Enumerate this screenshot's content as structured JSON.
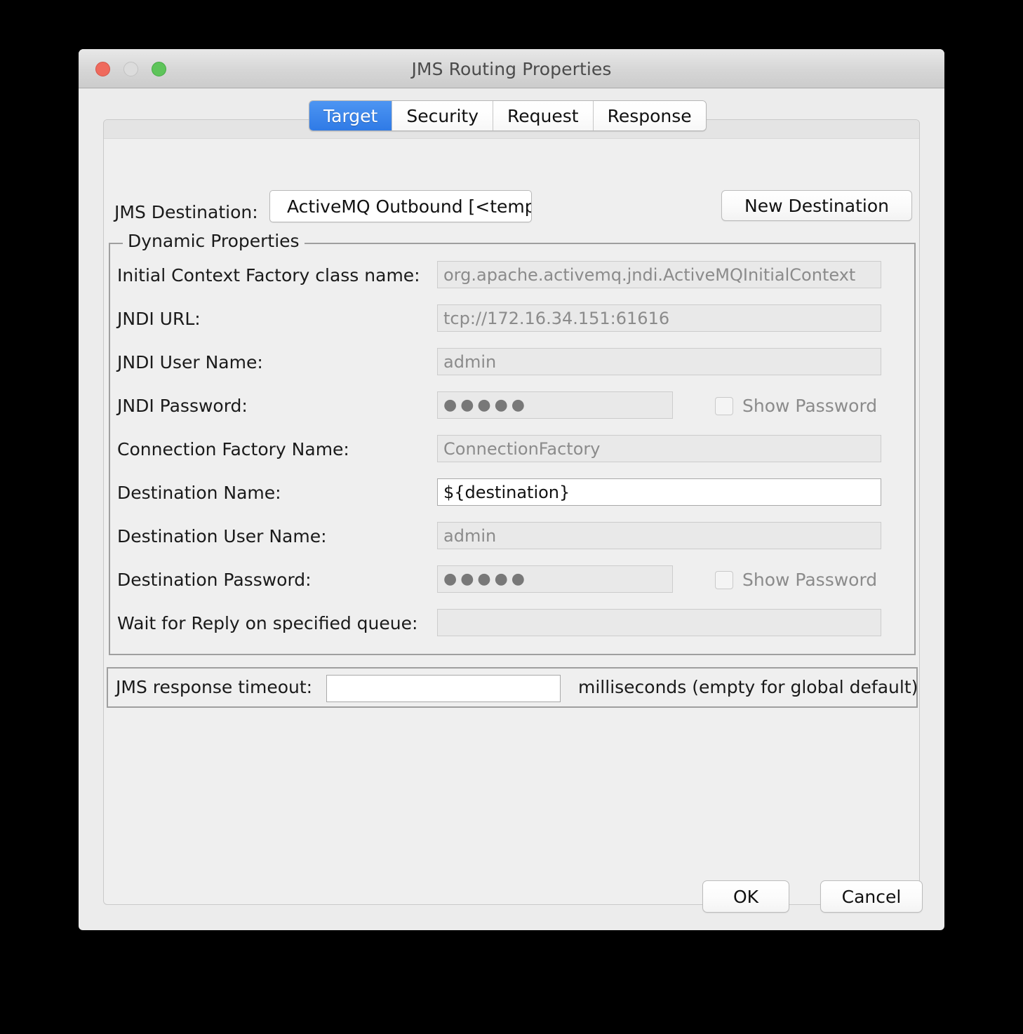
{
  "window": {
    "title": "JMS Routing Properties",
    "traffic_lights": [
      {
        "name": "close",
        "color": "#ef6a5d"
      },
      {
        "name": "minimize",
        "color": "#dcdcdc"
      },
      {
        "name": "zoom",
        "color": "#5ec45a"
      }
    ]
  },
  "tabs": [
    {
      "label": "Target",
      "active": true
    },
    {
      "label": "Security",
      "active": false
    },
    {
      "label": "Request",
      "active": false
    },
    {
      "label": "Response",
      "active": false
    }
  ],
  "destination_row": {
    "label": "JMS Destination:",
    "selected": "ActiveMQ Outbound [<template>]",
    "new_button": "New Destination"
  },
  "dynamic_properties": {
    "title": "Dynamic Properties",
    "fields": [
      {
        "label": "Initial Context Factory class name:",
        "value": "org.apache.activemq.jndi.ActiveMQInitialContext",
        "editable": false,
        "type": "text"
      },
      {
        "label": "JNDI URL:",
        "value": "tcp://172.16.34.151:61616",
        "editable": false,
        "type": "text"
      },
      {
        "label": "JNDI User Name:",
        "value": "admin",
        "editable": false,
        "type": "text"
      },
      {
        "label": "JNDI Password:",
        "value": "●●●●●",
        "editable": false,
        "type": "password"
      },
      {
        "label": "Connection Factory Name:",
        "value": "ConnectionFactory",
        "editable": false,
        "type": "text"
      },
      {
        "label": "Destination Name:",
        "value": "${destination}",
        "editable": true,
        "type": "text"
      },
      {
        "label": "Destination User Name:",
        "value": "admin",
        "editable": false,
        "type": "text"
      },
      {
        "label": "Destination Password:",
        "value": "●●●●●",
        "editable": false,
        "type": "password"
      },
      {
        "label": "Wait for Reply on specified queue:",
        "value": "",
        "editable": false,
        "type": "text"
      }
    ],
    "show_password_jndi": "Show Password",
    "show_password_destination": "Show Password"
  },
  "timeout": {
    "label": "JMS response timeout:",
    "value": "",
    "suffix": "milliseconds (empty for global default)"
  },
  "footer": {
    "ok": "OK",
    "cancel": "Cancel"
  },
  "colors": {
    "accent_blue": "#2f7ae6",
    "window_bg": "#ececec",
    "panel_bg": "#efefef",
    "disabled_text": "#8b8b8b"
  }
}
